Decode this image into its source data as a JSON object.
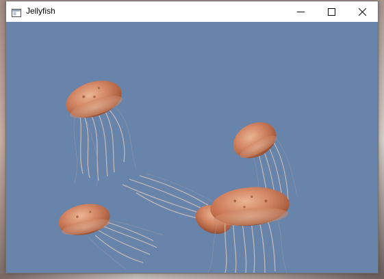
{
  "window": {
    "title": "Jellyfish",
    "controls": {
      "minimize": "minimize",
      "maximize": "maximize",
      "close": "close"
    }
  },
  "scene": {
    "background_color": "#6884aa",
    "jellyfish_count": 5
  },
  "colors": {
    "bell": "#c8764f",
    "bell_highlight": "#f0b490",
    "tentacle": "#e8c7b8"
  }
}
